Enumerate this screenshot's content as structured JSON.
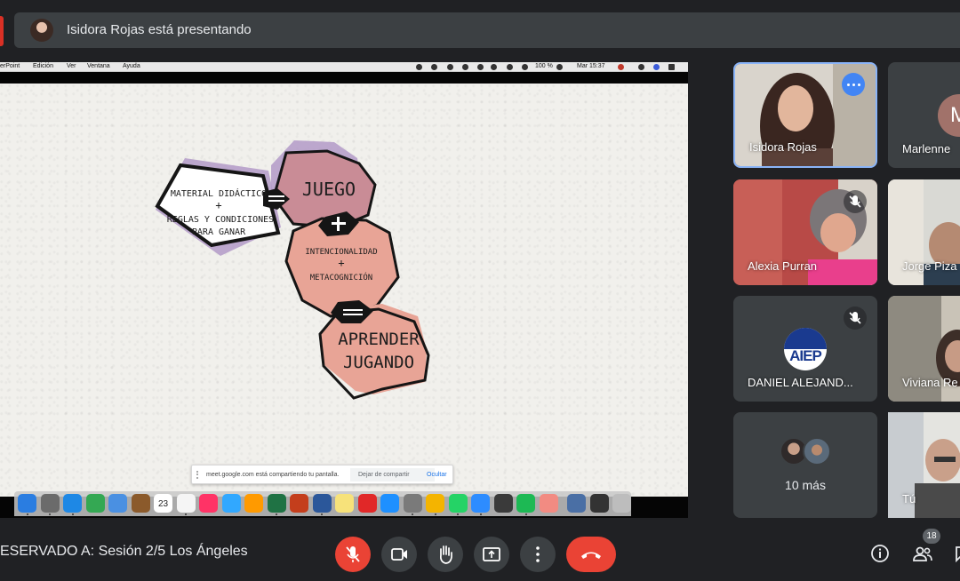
{
  "banner": {
    "presenter_text": "Isidora Rojas está presentando"
  },
  "mac_menubar": {
    "app": "erPoint",
    "menus": [
      "Edición",
      "Ver",
      "Ventana",
      "Ayuda"
    ],
    "battery": "100 %",
    "clock": "Mar 15:37"
  },
  "slide": {
    "shape1": [
      "MATERIAL DIDÁCTICO",
      "+",
      "REGLAS Y CONDICIONES",
      "PARA GANAR"
    ],
    "shape2": "JUEGO",
    "shape3": [
      "INTENCIONALIDAD",
      "+",
      "METACOGNICIÓN"
    ],
    "shape4": [
      "APRENDER",
      "JUGANDO"
    ],
    "colors": {
      "purple": "#b39ac8",
      "mauve": "#c98c96",
      "salmon": "#e8a496",
      "outline": "#151515"
    }
  },
  "share_bar": {
    "message": "meet.google.com está compartiendo tu pantalla.",
    "stop_label": "Dejar de compartir",
    "hide_label": "Ocultar"
  },
  "dock": {
    "calendar_day": "23",
    "icons": [
      "finder-icon",
      "launchpad-icon",
      "safari-icon",
      "facetime-icon",
      "messages-icon",
      "notes-book-icon",
      "calendar-icon",
      "reminders-icon",
      "indesign-icon",
      "photoshop-icon",
      "illustrator-icon",
      "excel-icon",
      "powerpoint-icon",
      "word-icon",
      "stickies-icon",
      "flipboard-icon",
      "app-store-icon",
      "system-preferences-icon",
      "chrome-icon",
      "whatsapp-icon",
      "zoom-icon",
      "app-icon",
      "spotify-icon",
      "photos-icon",
      "preview-icon",
      "terminal-icon",
      "trash-icon"
    ]
  },
  "participants": {
    "isidora": {
      "name": "Isidora Rojas"
    },
    "marlenne": {
      "name": "Marlenne",
      "initial": "M"
    },
    "alexia": {
      "name": "Alexia Purran"
    },
    "jorge": {
      "name": "Jorge Piza"
    },
    "daniel": {
      "name": "DANIEL ALEJAND...",
      "logo_text": "AIEP"
    },
    "viviana": {
      "name": "Viviana Re"
    },
    "more": {
      "label": "10 más"
    },
    "last": {
      "name": "Tú"
    }
  },
  "bottom_bar": {
    "meeting_title": "ESERVADO A: Sesión 2/5 Los Ángeles",
    "participant_count": "18"
  }
}
